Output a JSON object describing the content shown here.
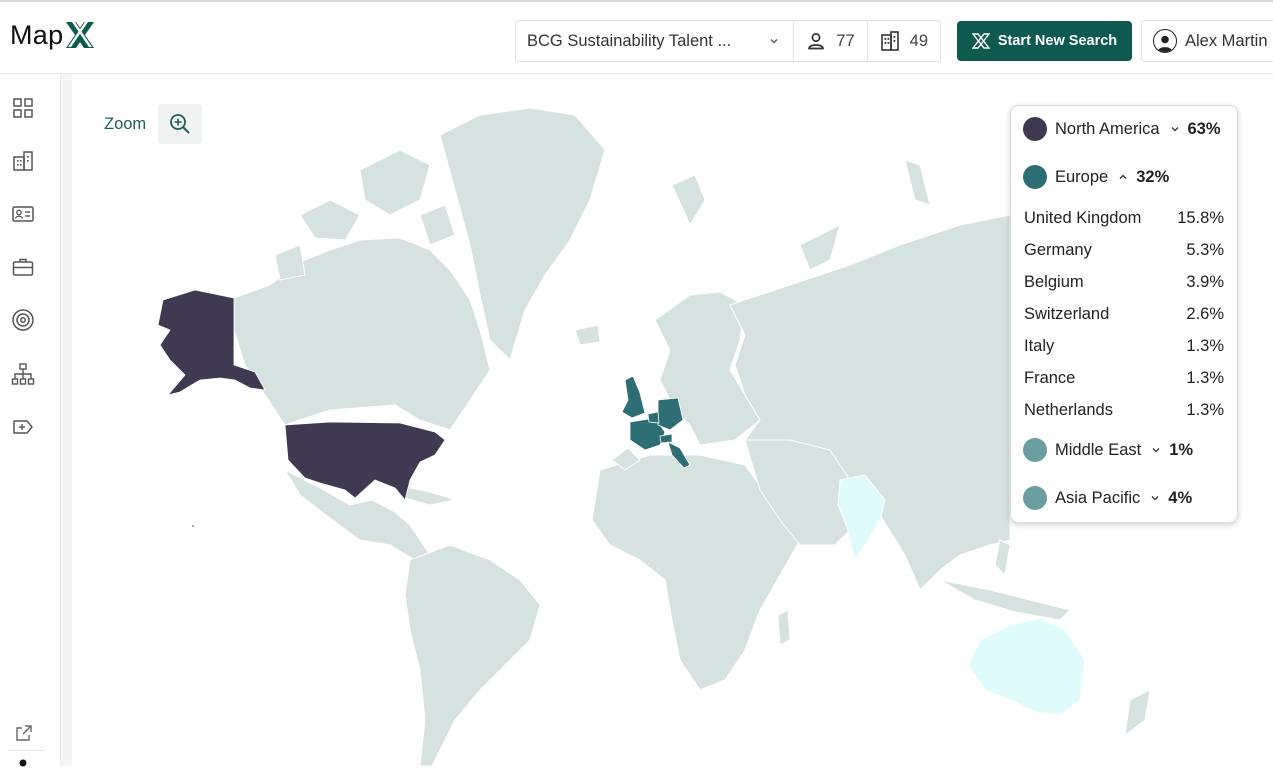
{
  "header": {
    "logo_text": "Map",
    "search_label": "BCG Sustainability Talent ...",
    "people_count": "77",
    "company_count": "49",
    "start_button_label": "Start New Search",
    "user_name": "Alex Martin"
  },
  "sidebar": {
    "items": [
      {
        "icon": "grid-icon"
      },
      {
        "icon": "building-icon"
      },
      {
        "icon": "contact-card-icon"
      },
      {
        "icon": "briefcase-icon"
      },
      {
        "icon": "target-icon"
      },
      {
        "icon": "org-chart-icon"
      },
      {
        "icon": "tag-icon"
      }
    ],
    "bottom": [
      {
        "icon": "external-link-icon"
      }
    ]
  },
  "map": {
    "zoom_label": "Zoom",
    "colors": {
      "base": "#d6e2e0",
      "north_america": "#3f3a52",
      "europe": "#2c6e73",
      "middle_east": "#6a9ea1",
      "asia_pacific": "#e0fbfb"
    }
  },
  "legend": {
    "regions": [
      {
        "name": "North America",
        "pct": "63%",
        "color": "#3f3a52",
        "expanded": false
      },
      {
        "name": "Europe",
        "pct": "32%",
        "color": "#2c6e73",
        "expanded": true
      },
      {
        "name": "Middle East",
        "pct": "1%",
        "color": "#6a9ea1",
        "expanded": false
      },
      {
        "name": "Asia Pacific",
        "pct": "4%",
        "color": "#6a9ea1",
        "expanded": false
      }
    ],
    "europe_countries": [
      {
        "name": "United Kingdom",
        "pct": "15.8%"
      },
      {
        "name": "Germany",
        "pct": "5.3%"
      },
      {
        "name": "Belgium",
        "pct": "3.9%"
      },
      {
        "name": "Switzerland",
        "pct": "2.6%"
      },
      {
        "name": "Italy",
        "pct": "1.3%"
      },
      {
        "name": "France",
        "pct": "1.3%"
      },
      {
        "name": "Netherlands",
        "pct": "1.3%"
      }
    ]
  }
}
